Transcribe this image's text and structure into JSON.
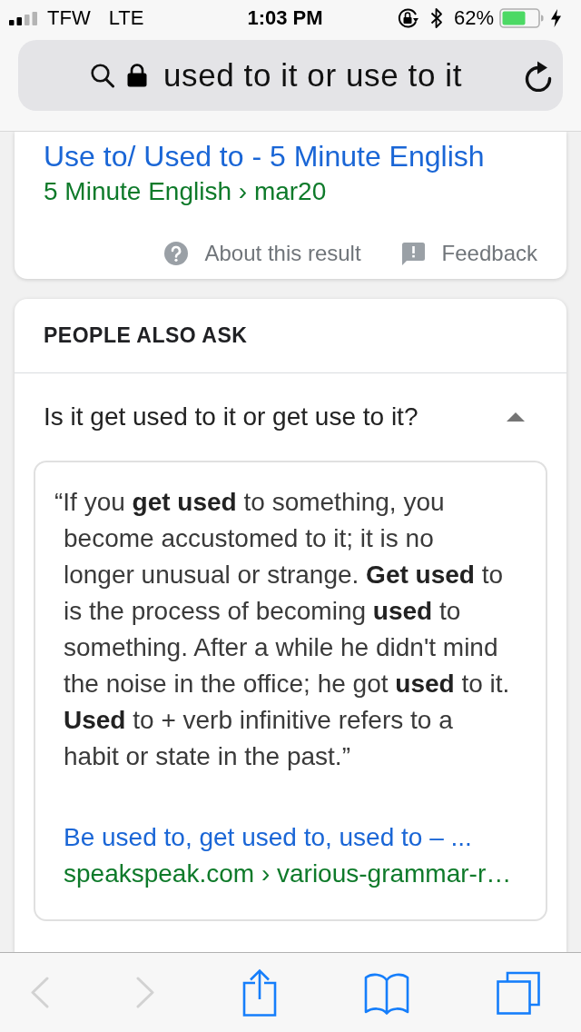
{
  "status_bar": {
    "carrier": "TFW",
    "network": "LTE",
    "time": "1:03 PM",
    "battery": "62%"
  },
  "address_bar": {
    "value": "used to it or use to it"
  },
  "result": {
    "title": "Use to/ Used to - 5 Minute English",
    "breadcrumb": "5 Minute English › mar20",
    "actions": [
      {
        "kind": "help",
        "label": "About this result"
      },
      {
        "kind": "feedback",
        "label": "Feedback"
      }
    ]
  },
  "people_also_ask": {
    "heading": "PEOPLE ALSO ASK",
    "questions": [
      {
        "question": "Is it get used to it or get use to it?",
        "expanded": true,
        "answer": {
          "text": "“If you **get used** to something, you become accustomed to it; it is no longer unusual or strange. **Get used** to is the process of becoming **used** to something. After a while he didn't mind the noise in the office; he got **used** to it. **Used** to + verb infinitive refers to a habit or state in the past.”",
          "link": "Be used to, get used to, used to – ...",
          "source": "speakspeak.com › various-grammar-r…"
        }
      }
    ]
  },
  "toolbar": {
    "items": [
      {
        "kind": "back",
        "disabled": true
      },
      {
        "kind": "forward",
        "disabled": true
      },
      {
        "kind": "share",
        "disabled": false
      },
      {
        "kind": "bookmarks",
        "disabled": false
      },
      {
        "kind": "tabs",
        "disabled": false
      }
    ]
  }
}
